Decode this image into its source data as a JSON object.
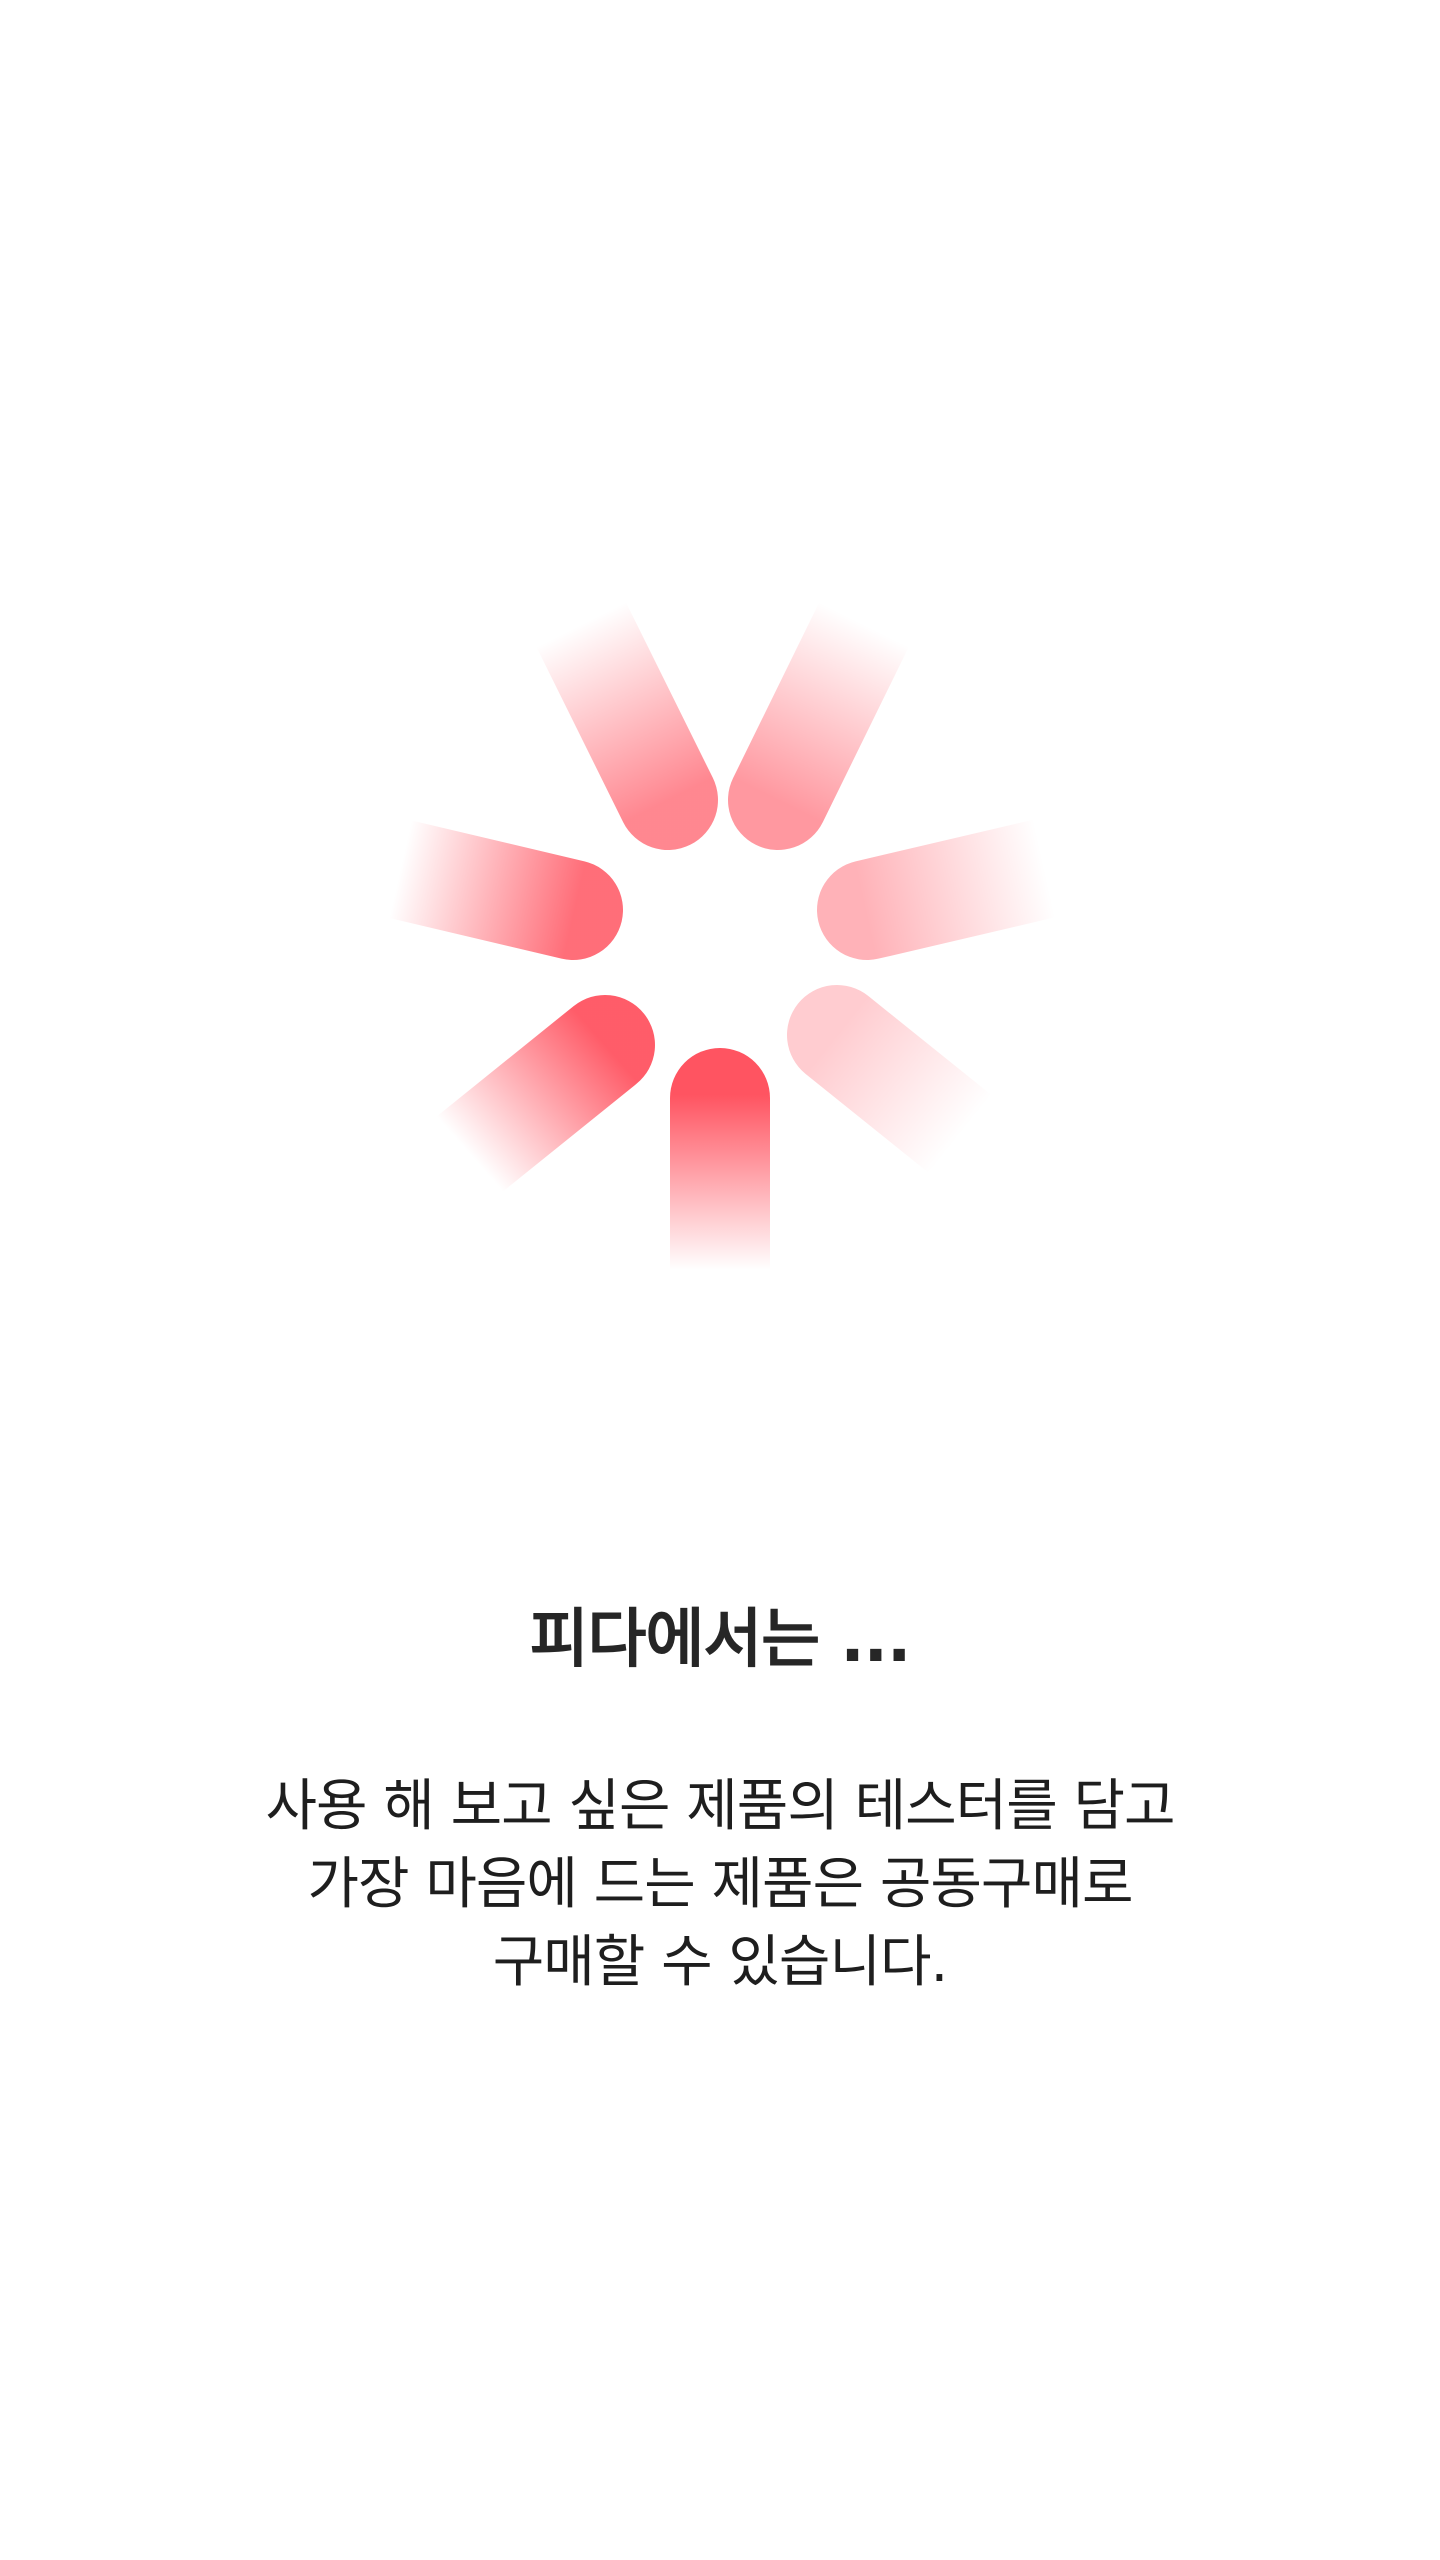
{
  "loader": {
    "icon": "loading-spinner-icon",
    "accent_color": "#ff5461"
  },
  "intro": {
    "title": "피다에서는 ...",
    "description_lines": [
      "사용 해 보고 싶은 제품의 테스터를 담고",
      "가장 마음에 드는 제품은 공동구매로",
      "구매할 수 있습니다."
    ]
  }
}
